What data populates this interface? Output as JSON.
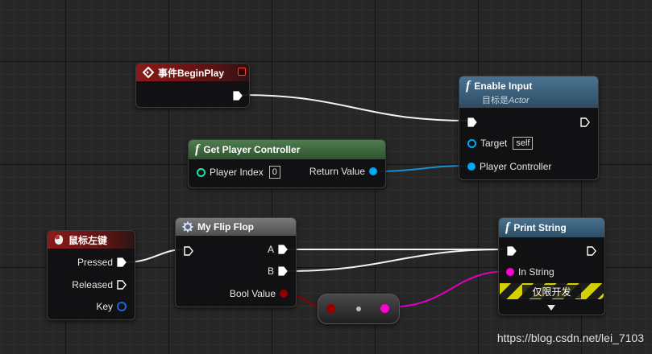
{
  "nodes": {
    "begin_play": {
      "title": "事件BeginPlay"
    },
    "enable_input": {
      "title": "Enable Input",
      "subtitle_prefix": "目标是",
      "subtitle_target": "Actor",
      "pins": {
        "target": "Target",
        "target_value": "self",
        "player_controller": "Player Controller"
      }
    },
    "get_player_controller": {
      "title": "Get Player Controller",
      "pins": {
        "player_index": "Player Index",
        "player_index_value": "0",
        "return_value": "Return Value"
      }
    },
    "left_mouse": {
      "title": "鼠标左键",
      "pins": {
        "pressed": "Pressed",
        "released": "Released",
        "key": "Key"
      }
    },
    "flip_flop": {
      "title": "My Flip Flop",
      "pins": {
        "a": "A",
        "b": "B",
        "bool_value": "Bool Value"
      }
    },
    "print_string": {
      "title": "Print String",
      "pins": {
        "in_string": "In String"
      },
      "dev_only": "仅限开发"
    }
  },
  "watermark": "https://blog.csdn.net/lei_7103",
  "colors": {
    "exec": "#ffffff",
    "object": "#00a8f2",
    "bool": "#940000",
    "string": "#ff00d4",
    "event_header": "#8c1a1a",
    "function_header": "#3b5e7a",
    "pure_header": "#3d6b3d",
    "macro_header": "#6a6a6a"
  }
}
